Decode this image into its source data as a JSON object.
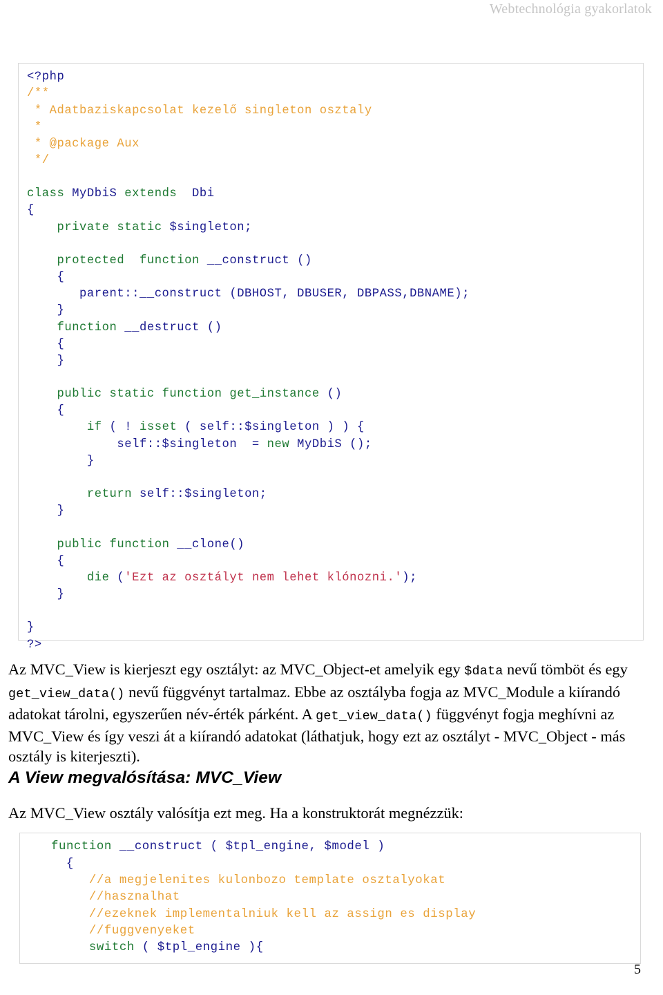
{
  "header": {
    "running_title": "Webtechnológia gyakorlatok"
  },
  "code_block_1": {
    "language": "php",
    "lines": [
      [
        {
          "t": "<?php",
          "c": "tag"
        }
      ],
      [
        {
          "t": "/**",
          "c": "com"
        }
      ],
      [
        {
          "t": " * Adatbaziskapcsolat kezelő singleton osztaly",
          "c": "com"
        }
      ],
      [
        {
          "t": " *",
          "c": "com"
        }
      ],
      [
        {
          "t": " * @package Aux",
          "c": "com"
        }
      ],
      [
        {
          "t": " */",
          "c": "com"
        }
      ],
      [
        {
          "t": "",
          "c": "id"
        }
      ],
      [
        {
          "t": "class",
          "c": "kw"
        },
        {
          "t": " MyDbiS ",
          "c": "id"
        },
        {
          "t": "extends",
          "c": "kw"
        },
        {
          "t": "  Dbi",
          "c": "id"
        }
      ],
      [
        {
          "t": "{",
          "c": "id"
        }
      ],
      [
        {
          "t": "    ",
          "c": "id"
        },
        {
          "t": "private static",
          "c": "kw"
        },
        {
          "t": " $singleton;",
          "c": "id"
        }
      ],
      [
        {
          "t": "",
          "c": "id"
        }
      ],
      [
        {
          "t": "    ",
          "c": "id"
        },
        {
          "t": "protected  function",
          "c": "kw"
        },
        {
          "t": " __construct ()",
          "c": "id"
        }
      ],
      [
        {
          "t": "    {",
          "c": "id"
        }
      ],
      [
        {
          "t": "       parent::__construct (DBHOST, DBUSER, DBPASS,DBNAME);",
          "c": "id"
        }
      ],
      [
        {
          "t": "    }",
          "c": "id"
        }
      ],
      [
        {
          "t": "    ",
          "c": "id"
        },
        {
          "t": "function",
          "c": "kw"
        },
        {
          "t": " __destruct ()",
          "c": "id"
        }
      ],
      [
        {
          "t": "    {",
          "c": "id"
        }
      ],
      [
        {
          "t": "    }",
          "c": "id"
        }
      ],
      [
        {
          "t": "",
          "c": "id"
        }
      ],
      [
        {
          "t": "    ",
          "c": "id"
        },
        {
          "t": "public static function",
          "c": "kw"
        },
        {
          "t": " ",
          "c": "id"
        },
        {
          "t": "get_instance",
          "c": "kw"
        },
        {
          "t": " ()",
          "c": "id"
        }
      ],
      [
        {
          "t": "    {",
          "c": "id"
        }
      ],
      [
        {
          "t": "        ",
          "c": "id"
        },
        {
          "t": "if",
          "c": "kw"
        },
        {
          "t": " ( ! ",
          "c": "id"
        },
        {
          "t": "isset",
          "c": "kw"
        },
        {
          "t": " ( self::$singleton ) ) {",
          "c": "id"
        }
      ],
      [
        {
          "t": "            self::$singleton  = ",
          "c": "id"
        },
        {
          "t": "new",
          "c": "kw"
        },
        {
          "t": " MyDbiS ();",
          "c": "id"
        }
      ],
      [
        {
          "t": "        }",
          "c": "id"
        }
      ],
      [
        {
          "t": "",
          "c": "id"
        }
      ],
      [
        {
          "t": "        ",
          "c": "id"
        },
        {
          "t": "return",
          "c": "kw"
        },
        {
          "t": " self::$singleton;",
          "c": "id"
        }
      ],
      [
        {
          "t": "    }",
          "c": "id"
        }
      ],
      [
        {
          "t": "",
          "c": "id"
        }
      ],
      [
        {
          "t": "    ",
          "c": "id"
        },
        {
          "t": "public function",
          "c": "kw"
        },
        {
          "t": " __clone()",
          "c": "id"
        }
      ],
      [
        {
          "t": "    {",
          "c": "id"
        }
      ],
      [
        {
          "t": "        ",
          "c": "id"
        },
        {
          "t": "die",
          "c": "kw"
        },
        {
          "t": " (",
          "c": "id"
        },
        {
          "t": "'Ezt az osztályt nem lehet klónozni.'",
          "c": "str"
        },
        {
          "t": ");",
          "c": "id"
        }
      ],
      [
        {
          "t": "    }",
          "c": "id"
        }
      ],
      [
        {
          "t": "",
          "c": "id"
        }
      ],
      [
        {
          "t": "}",
          "c": "id"
        }
      ],
      [
        {
          "t": "?>",
          "c": "tag"
        }
      ]
    ]
  },
  "paragraph_1": {
    "runs": [
      {
        "t": "Az MVC_View is kierjeszt egy osztályt: az MVC_Object-et amelyik egy ",
        "c": "text"
      },
      {
        "t": "$data",
        "c": "code"
      },
      {
        "t": " nevű tömböt és egy ",
        "c": "text"
      },
      {
        "t": "get_view_data()",
        "c": "code"
      },
      {
        "t": " nevű függvényt tartalmaz. Ebbe az osztályba fogja az MVC_Module a kiírandó adatokat tárolni, egyszerűen név-érték párként. A ",
        "c": "text"
      },
      {
        "t": "get_view_data()",
        "c": "code"
      },
      {
        "t": "  függvényt fogja meghívni az MVC_View és így veszi át a kiírandó adatokat (láthatjuk, hogy ezt az osztályt - MVC_Object - más osztály is kiterjeszti).",
        "c": "text"
      }
    ]
  },
  "section_heading": {
    "text": "A View megvalósítása: MVC_View"
  },
  "paragraph_2": {
    "runs": [
      {
        "t": "Az MVC_View osztály valósítja ezt meg. Ha a konstruktorát megnézzük:",
        "c": "text"
      }
    ]
  },
  "code_block_2": {
    "language": "php",
    "lines": [
      [
        {
          "t": "   ",
          "c": "id"
        },
        {
          "t": "function",
          "c": "kw"
        },
        {
          "t": " __construct ( $tpl_engine, $model )",
          "c": "id"
        }
      ],
      [
        {
          "t": "     {",
          "c": "id"
        }
      ],
      [
        {
          "t": "        ",
          "c": "id"
        },
        {
          "t": "//a megjelenites kulonbozo template osztalyokat",
          "c": "com"
        }
      ],
      [
        {
          "t": "        ",
          "c": "id"
        },
        {
          "t": "//hasznalhat",
          "c": "com"
        }
      ],
      [
        {
          "t": "        ",
          "c": "id"
        },
        {
          "t": "//ezeknek implementalniuk kell az assign es display",
          "c": "com"
        }
      ],
      [
        {
          "t": "        ",
          "c": "id"
        },
        {
          "t": "//fuggvenyeket",
          "c": "com"
        }
      ],
      [
        {
          "t": "        ",
          "c": "id"
        },
        {
          "t": "switch",
          "c": "kw"
        },
        {
          "t": " ( $tpl_engine ){",
          "c": "id"
        }
      ]
    ]
  },
  "footer": {
    "page_number": "5"
  },
  "colors": {
    "keyword": "#1f7a33",
    "identifier": "#1b1b8f",
    "comment": "#e9a33a",
    "string": "#c0334d",
    "header_gray": "#c6c6c6",
    "code_border": "#d9d9d9"
  }
}
